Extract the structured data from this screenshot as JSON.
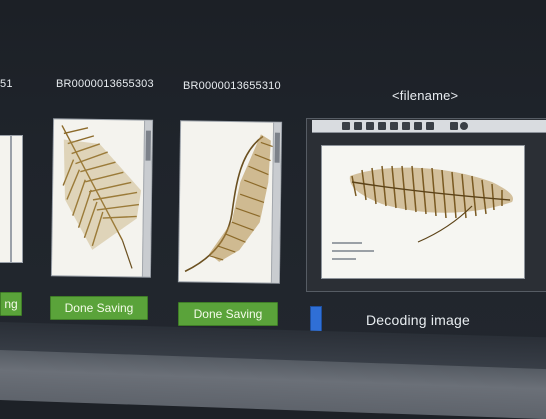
{
  "gallery": {
    "partial_label": "51",
    "items": [
      {
        "id_label": "BR0000013655303",
        "status_button": "Done Saving"
      },
      {
        "id_label": "BR0000013655310",
        "status_button": "Done Saving"
      }
    ],
    "partial_button": "ng"
  },
  "preview": {
    "title": "<filename>",
    "status_text": "Decoding image",
    "progress_fraction": 0.05
  },
  "colors": {
    "button_green": "#5aa33a",
    "progress_blue": "#2f6fd6",
    "background": "#1d2127"
  }
}
